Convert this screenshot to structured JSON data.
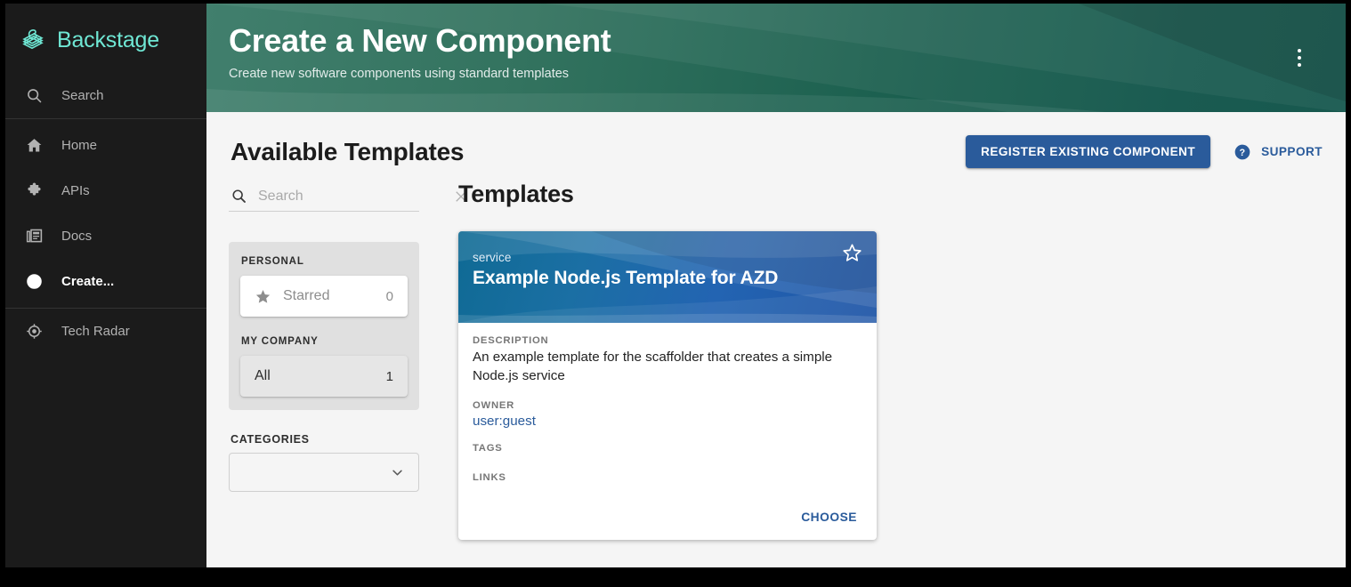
{
  "sidebar": {
    "brand": "Backstage",
    "search_item": "Search",
    "items": [
      {
        "label": "Home",
        "icon": "home-icon"
      },
      {
        "label": "APIs",
        "icon": "puzzle-icon"
      },
      {
        "label": "Docs",
        "icon": "docs-icon"
      },
      {
        "label": "Create...",
        "icon": "plus-circle-icon"
      },
      {
        "label": "Tech Radar",
        "icon": "radar-icon"
      }
    ]
  },
  "header": {
    "title": "Create a New Component",
    "subtitle": "Create new software components using standard templates",
    "menu_icon": "more-vert-icon"
  },
  "section": {
    "title": "Available Templates",
    "register_button": "REGISTER EXISTING COMPONENT",
    "support_label": "SUPPORT"
  },
  "filters": {
    "search_placeholder": "Search",
    "search_value": "",
    "personal_heading": "PERSONAL",
    "starred_label": "Starred",
    "starred_count": "0",
    "company_heading": "MY COMPANY",
    "all_label": "All",
    "all_count": "1",
    "categories_heading": "CATEGORIES",
    "categories_value": ""
  },
  "results": {
    "title": "Templates",
    "cards": [
      {
        "kind": "service",
        "name": "Example Node.js Template for AZD",
        "description_label": "DESCRIPTION",
        "description": "An example template for the scaffolder that creates a simple Node.js service",
        "owner_label": "OWNER",
        "owner": "user:guest",
        "tags_label": "TAGS",
        "links_label": "LINKS",
        "choose_label": "CHOOSE"
      }
    ]
  },
  "colors": {
    "sidebar_bg": "#1b1b1b",
    "brand_accent": "#6fe7d4",
    "header_green_start": "#417f6d",
    "header_green_end": "#0a4f44",
    "primary_blue": "#2a5b9b",
    "card_blue_start": "#0f6a94",
    "card_blue_end": "#1f55a6",
    "page_bg": "#f5f5f5"
  }
}
